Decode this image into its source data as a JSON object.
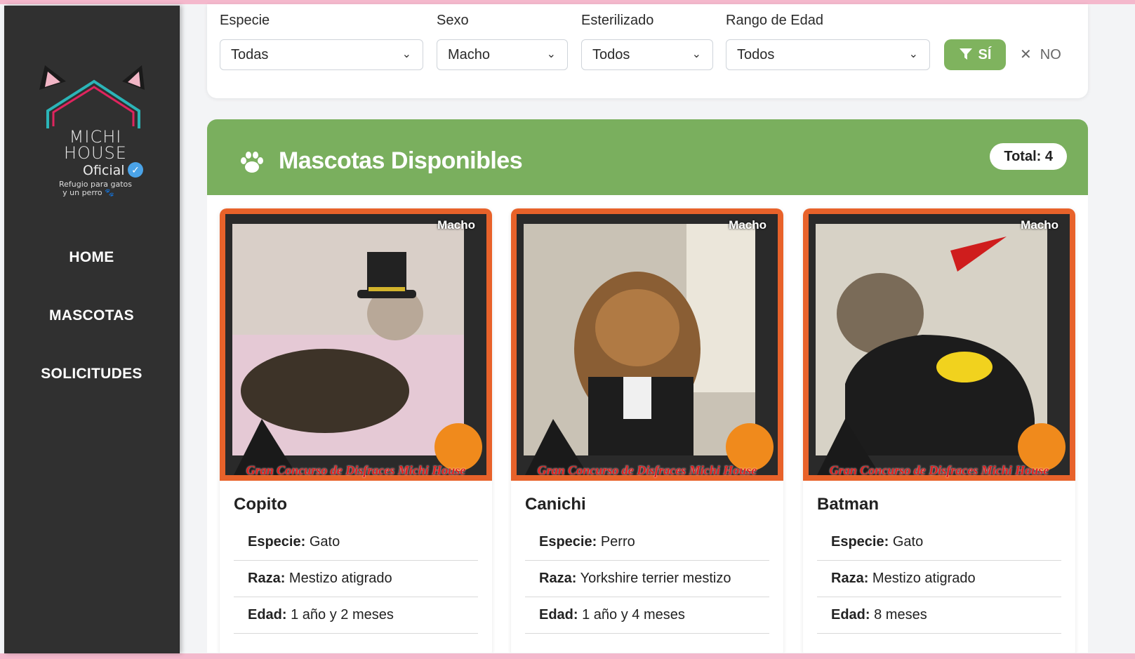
{
  "sidebar": {
    "logo": {
      "line1": "MICHI",
      "line2": "HOUSE",
      "line3": "Oficial",
      "tagline1": "Refugio para gatos",
      "tagline2": "y un perro 🐾",
      "accent_teal": "#2bb5b8",
      "accent_pink": "#e0245e"
    },
    "nav": [
      "HOME",
      "MASCOTAS",
      "SOLICITUDES"
    ]
  },
  "filters": {
    "especie": {
      "label": "Especie",
      "value": "Todas"
    },
    "sexo": {
      "label": "Sexo",
      "value": "Macho"
    },
    "esterilizado": {
      "label": "Esterilizado",
      "value": "Todos"
    },
    "edad": {
      "label": "Rango de Edad",
      "value": "Todos"
    },
    "apply_label": "SÍ",
    "clear_label": "NO"
  },
  "section": {
    "title": "Mascotas Disponibles",
    "total": "Total: 4",
    "header_color": "#7aaf5e"
  },
  "pets": [
    {
      "name": "Copito",
      "sex": "Macho",
      "especie_label": "Especie:",
      "especie": "Gato",
      "raza_label": "Raza:",
      "raza": "Mestizo atigrado",
      "edad_label": "Edad:",
      "edad": "1 año y 2 meses",
      "banner": "Gran Concurso de Disfraces Michi House"
    },
    {
      "name": "Canichi",
      "sex": "Macho",
      "especie_label": "Especie:",
      "especie": "Perro",
      "raza_label": "Raza:",
      "raza": "Yorkshire terrier mestizo",
      "edad_label": "Edad:",
      "edad": "1 año y 4 meses",
      "banner": "Gran Concurso de Disfraces Michi House"
    },
    {
      "name": "Batman",
      "sex": "Macho",
      "especie_label": "Especie:",
      "especie": "Gato",
      "raza_label": "Raza:",
      "raza": "Mestizo atigrado",
      "edad_label": "Edad:",
      "edad": "8 meses",
      "banner": "Gran Concurso de Disfraces Michi House"
    }
  ]
}
